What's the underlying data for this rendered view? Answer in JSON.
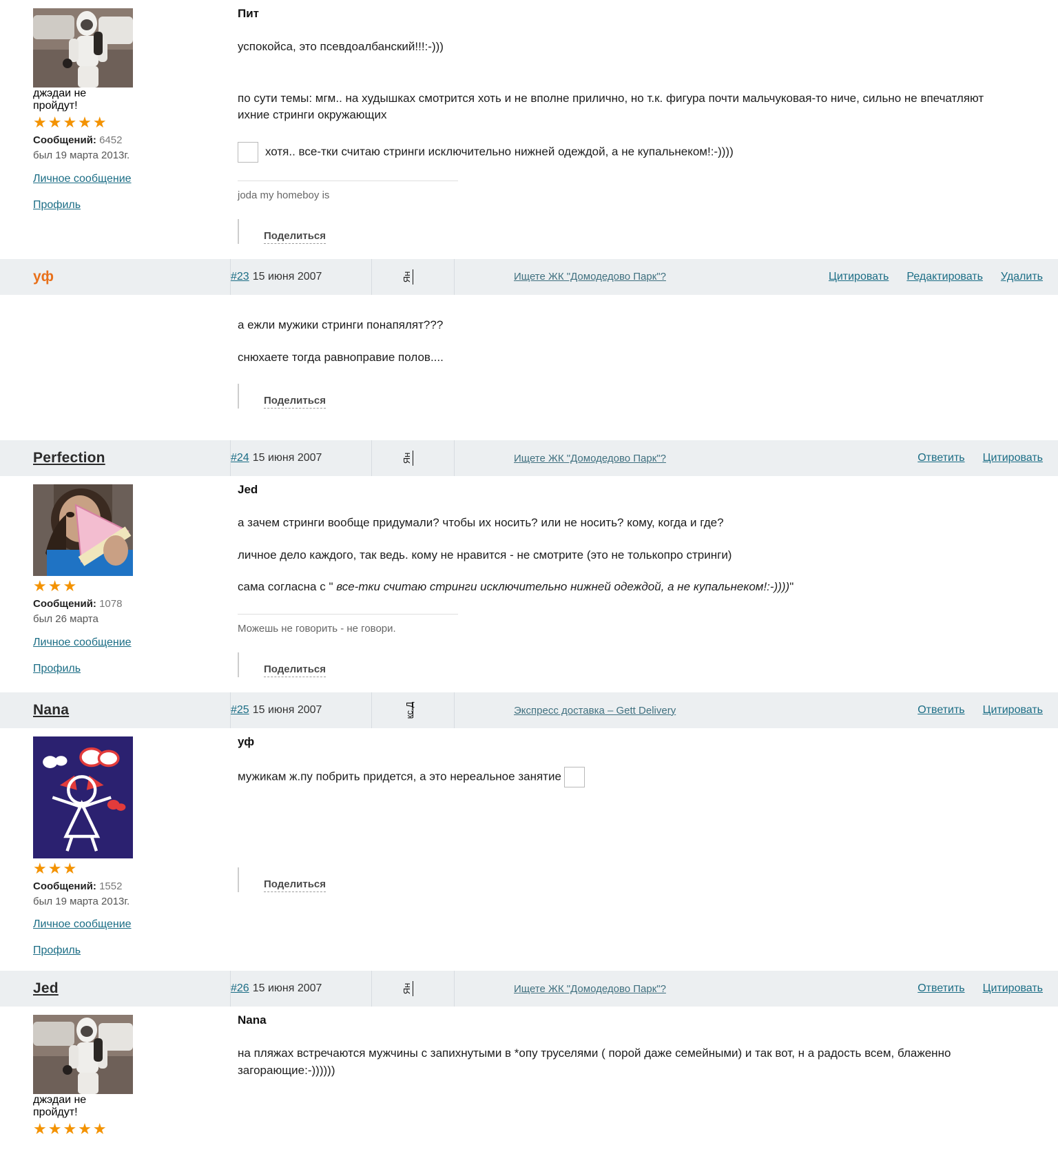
{
  "labels": {
    "messages": "Сообщений:",
    "pm": "Личное сообщение",
    "profile": "Профиль",
    "share": "Поделиться",
    "quote": "Цитировать",
    "edit": "Редактировать",
    "delete": "Удалить",
    "reply": "Ответить"
  },
  "posts": [
    {
      "id": "post-22-tail",
      "user": {
        "name": "Пит",
        "avatar_caption": "джэдаи не пройдут!",
        "stars": 5,
        "messages": "6452",
        "last_seen": "был 19 марта 2013г."
      },
      "quoted_name": "Пит",
      "paragraphs": [
        "успокойса, это псевдоалбанский!!!:-)))",
        "по сути темы: мгм.. на худышках смотрится хоть и не вполне прилично, но т.к. фигура почти мальчуковая-то ниче, сильно не впечатляют ихние стринги окружающих",
        "хотя.. все-тки считаю стринги исключительно нижней одеждой, а не купальнеком!:-))))"
      ],
      "signature": "joda my homeboy is"
    },
    {
      "id": "post-23",
      "header": {
        "username": "уф",
        "username_is_link": false,
        "post_number": "#23",
        "date": "15 июня 2007",
        "ad_mark": "Ян",
        "ad_text": "Ищете ЖК \"Домодедово Парк\"?",
        "actions": [
          "Цитировать",
          "Редактировать",
          "Удалить"
        ]
      },
      "paragraphs": [
        "а ежли мужики стринги понапялят???",
        "снюхаете тогда равноправие полов...."
      ]
    },
    {
      "id": "post-24",
      "header": {
        "username": "Perfection",
        "username_is_link": true,
        "post_number": "#24",
        "date": "15 июня 2007",
        "ad_mark": "Ян",
        "ad_text": "Ищете ЖК \"Домодедово Парк\"?",
        "actions": [
          "Ответить",
          "Цитировать"
        ]
      },
      "user": {
        "stars": 3,
        "messages": "1078",
        "last_seen": "был 26 марта"
      },
      "quoted_name": "Jed",
      "paragraphs": [
        "а зачем стринги вообще придумали? чтобы их носить? или не носить? кому, когда и где?",
        "личное дело каждого, так ведь. кому не нравится - не смотрите (это не толькопро стринги)"
      ],
      "quote_line_prefix": "сама согласна с \" ",
      "quote_line_italic": "все-тки считаю стринги исключительно нижней одеждой, а не купальнеком!:-))))",
      "quote_line_suffix": "\"",
      "signature": "Можешь не говорить - не говори."
    },
    {
      "id": "post-25",
      "header": {
        "username": "Nana",
        "username_is_link": true,
        "post_number": "#25",
        "date": "15 июня 2007",
        "ad_mark": "кс.Д",
        "ad_text": "Экспресс доставка – Gett Delivery",
        "actions": [
          "Ответить",
          "Цитировать"
        ]
      },
      "user": {
        "stars": 3,
        "messages": "1552",
        "last_seen": "был 19 марта 2013г."
      },
      "quoted_name": "уф",
      "paragraphs": [
        "мужикам ж.пу побрить придется, а это нереальное занятие"
      ]
    },
    {
      "id": "post-26",
      "header": {
        "username": "Jed",
        "username_is_link": true,
        "post_number": "#26",
        "date": "15 июня 2007",
        "ad_mark": "Ян",
        "ad_text": "Ищете ЖК \"Домодедово Парк\"?",
        "actions": [
          "Ответить",
          "Цитировать"
        ]
      },
      "user": {
        "avatar_caption": "джэдаи не пройдут!",
        "stars": 5
      },
      "quoted_name": "Nana",
      "paragraphs": [
        "на пляжах встречаются мужчины с запихнутыми в *опу труселями ( порой даже семейными) и так вот, н а радость всем, блаженно загорающие:-))))))"
      ]
    }
  ]
}
